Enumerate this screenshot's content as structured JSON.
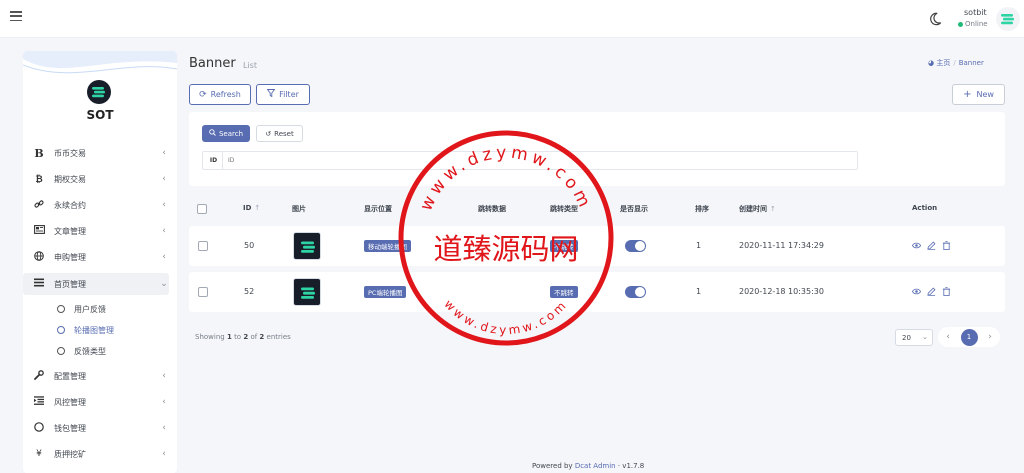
{
  "header": {
    "user_name": "sotbit",
    "user_status": "Online"
  },
  "sidebar": {
    "brand": "SOT",
    "menu": [
      {
        "label": "币币交易",
        "icon": "bitcoin-b-icon"
      },
      {
        "label": "期权交易",
        "icon": "bitcoin-icon"
      },
      {
        "label": "永续合约",
        "icon": "link-icon"
      },
      {
        "label": "文章管理",
        "icon": "newspaper-icon"
      },
      {
        "label": "申购管理",
        "icon": "globe-icon"
      },
      {
        "label": "首页管理",
        "icon": "list-icon",
        "open": true,
        "children": [
          {
            "label": "用户反馈"
          },
          {
            "label": "轮播图管理",
            "active": true
          },
          {
            "label": "反馈类型"
          }
        ]
      },
      {
        "label": "配置管理",
        "icon": "wrench-icon"
      },
      {
        "label": "风控管理",
        "icon": "indent-icon"
      },
      {
        "label": "钱包管理",
        "icon": "circle-icon"
      },
      {
        "label": "质押挖矿",
        "icon": "yen-icon"
      }
    ]
  },
  "page": {
    "title": "Banner",
    "subtitle": "List",
    "breadcrumb_home": "主页",
    "breadcrumb_current": "Banner"
  },
  "toolbar": {
    "refresh": "Refresh",
    "filter": "Filter",
    "new": "New"
  },
  "filter": {
    "search": "Search",
    "reset": "Reset",
    "id_label": "ID",
    "id_placeholder": "ID"
  },
  "table": {
    "headers": [
      "ID",
      "图片",
      "显示位置",
      "跳转数据",
      "跳转类型",
      "是否显示",
      "排序",
      "创建时间",
      "Action"
    ],
    "rows": [
      {
        "id": "50",
        "position": "移动端轮播图",
        "jump_data": "",
        "jump_type": "不跳转",
        "show": true,
        "sort": "1",
        "created_at": "2020-11-11 17:34:29"
      },
      {
        "id": "52",
        "position": "PC端轮播图",
        "jump_data": "",
        "jump_type": "不跳转",
        "show": true,
        "sort": "1",
        "created_at": "2020-12-18 10:35:30"
      }
    ]
  },
  "pagination": {
    "showing_prefix": "Showing",
    "from": "1",
    "to_word": "to",
    "to": "2",
    "of_word": "of",
    "total": "2",
    "entries_word": "entries",
    "per_page": "20",
    "current_page": "1"
  },
  "footer": {
    "powered_by": "Powered by",
    "link": "Dcat Admin",
    "version": "· v1.7.8"
  },
  "watermark": {
    "center_text": "道臻源码网",
    "arc_text": "www.dzymw.com"
  },
  "colors": {
    "accent": "#586cb1",
    "online": "#21b978",
    "stamp": "#e0161b"
  }
}
